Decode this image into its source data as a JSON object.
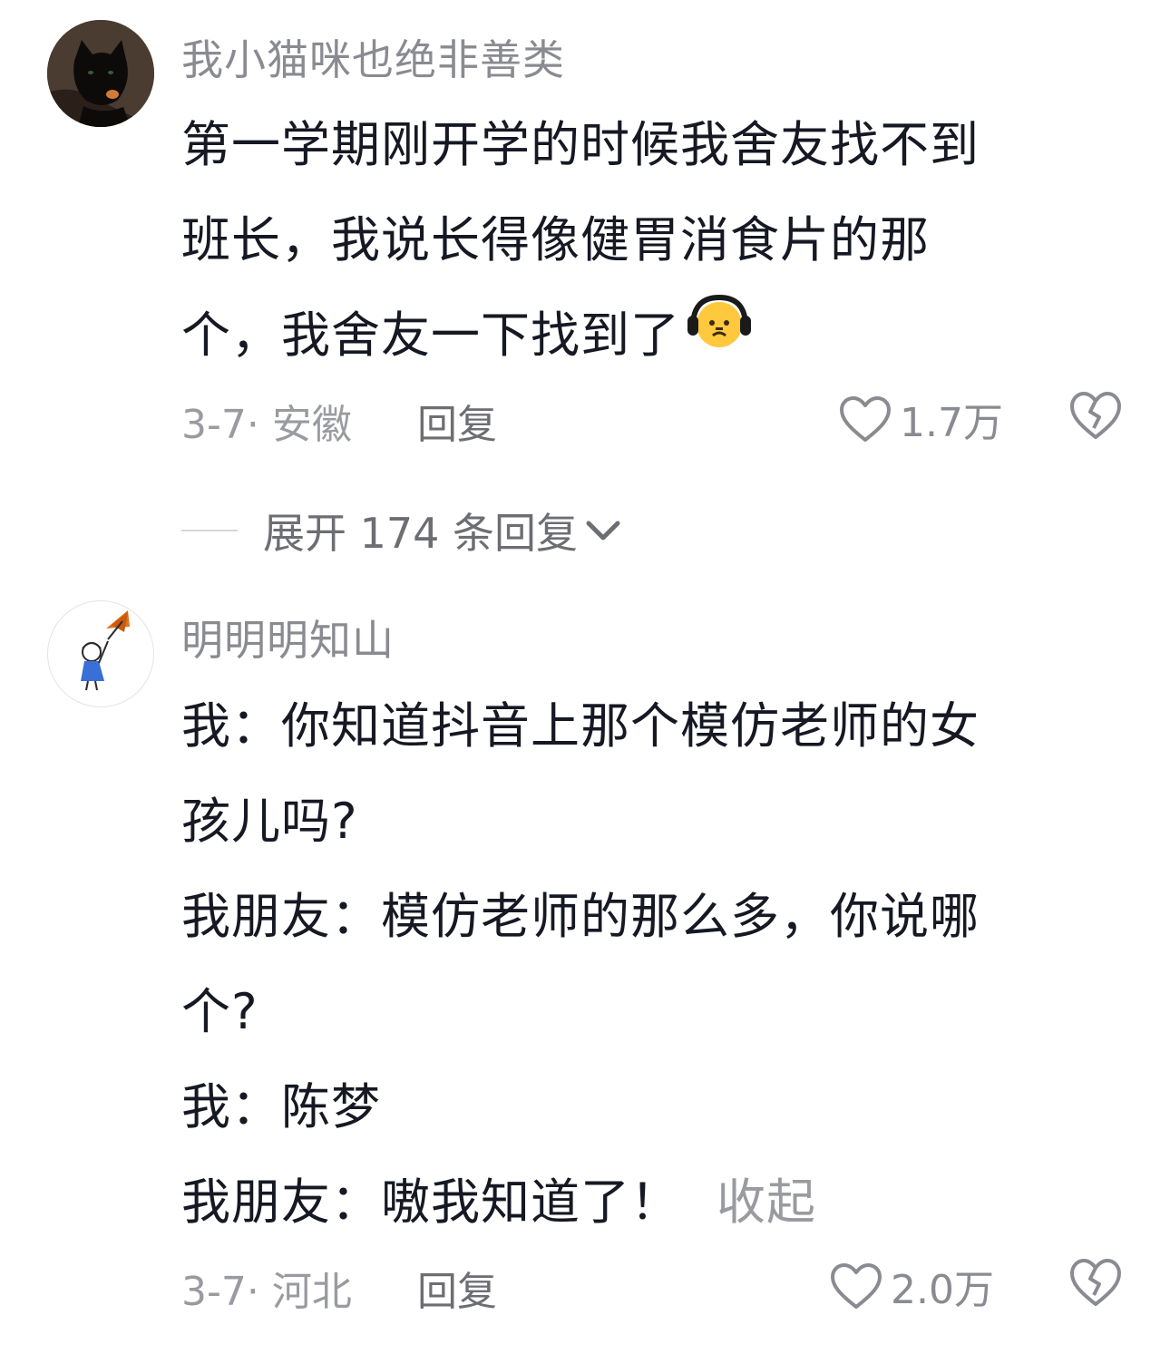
{
  "comments": [
    {
      "username": "我小猫咪也绝非善类",
      "avatar_icon": "black-cat-avatar",
      "lines": [
        "第一学期刚开学的时候我舍友找不到",
        "班长，我说长得像健胃消食片的那",
        "个，我舍友一下找到了"
      ],
      "emoji_icon": "headphones-face-emoji",
      "date_location": "3-7· 安徽",
      "reply_label": "回复",
      "like_count": "1.7万"
    },
    {
      "username": "明明明知山",
      "avatar_icon": "girl-with-umbrella-avatar",
      "lines": [
        "我：你知道抖音上那个模仿老师的女",
        "孩儿吗?",
        "我朋友：模仿老师的那么多，你说哪",
        "个?",
        "我：陈梦",
        "我朋友：嗷我知道了！"
      ],
      "collapse_label": "收起",
      "date_location": "3-7· 河北",
      "reply_label": "回复",
      "like_count": "2.0万"
    }
  ],
  "expand_replies": {
    "label": "展开 174 条回复"
  },
  "colors": {
    "text_primary": "#161823",
    "text_secondary": "#8a8b91",
    "background": "#ffffff"
  }
}
